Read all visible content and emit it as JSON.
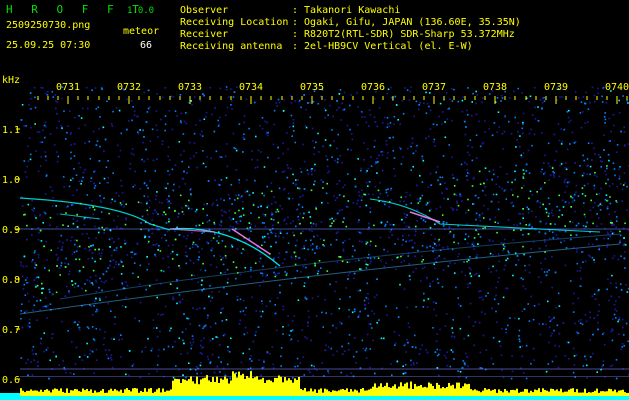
{
  "header": {
    "app_name": "H R O F F T",
    "version": "1.0.0",
    "filename": "2509250730.png",
    "timestamp": "25.09.25 07:30",
    "type_label": "meteor",
    "count": "66",
    "observer_label": "Observer",
    "observer_value": ": Takanori Kawachi",
    "location_label": "Receiving Location",
    "location_value": ": Ogaki, Gifu, JAPAN (136.60E, 35.35N)",
    "receiver_label": "Receiver",
    "receiver_value": ": R820T2(RTL-SDR) SDR-Sharp 53.372MHz",
    "antenna_label": "Receiving antenna",
    "antenna_value": ": 2el-HB9CV Vertical (el. E-W)"
  },
  "spectrogram": {
    "unit_label": "kHz",
    "time_labels": [
      "0731",
      "0732",
      "0733",
      "0734",
      "0735",
      "0736",
      "0737",
      "0738",
      "0739",
      "0740"
    ],
    "freq_labels": [
      "1.1",
      "1.0",
      "0.9",
      "0.8",
      "0.7",
      "0.6"
    ],
    "colors": {
      "background": "#000000",
      "noise_low": "#1a1aa0",
      "noise_mid": "#0080ff",
      "signal": "#00ffff",
      "echo": "#ff80ff",
      "power_bar": "#ffff00",
      "power_base": "#00ffff",
      "labels": "#ffff00"
    }
  }
}
